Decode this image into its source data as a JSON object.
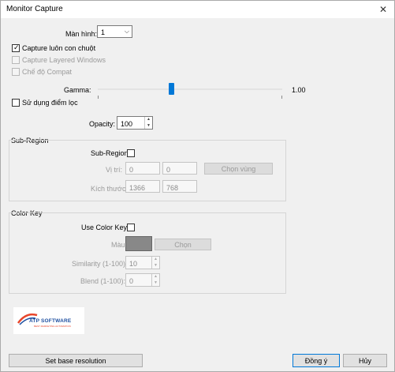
{
  "window": {
    "title": "Monitor Capture",
    "close_glyph": "✕"
  },
  "monitor": {
    "label": "Màn hình:",
    "value": "1",
    "arrow_glyph": "⌵"
  },
  "options": {
    "capture_cursor": {
      "label": "Capture luôn con chuột",
      "checked": true
    },
    "capture_layered": {
      "label": "Capture Layered Windows",
      "checked": false,
      "enabled": false
    },
    "compat_mode": {
      "label": "Chế độ Compat",
      "checked": false,
      "enabled": false
    }
  },
  "gamma": {
    "label": "Gamma:",
    "value_text": "1.00",
    "level": 0.4
  },
  "filter_point": {
    "label": "Sử dụng điểm lọc",
    "checked": false
  },
  "opacity": {
    "label": "Opacity:",
    "value": "100",
    "up_glyph": "▲",
    "down_glyph": "▼"
  },
  "sub_region": {
    "group_label": "Sub-Region",
    "enable_label": "Sub-Region",
    "position_label": "Vị trí:",
    "x": "0",
    "y": "0",
    "choose_button": "Chọn vùng",
    "size_label": "Kích thước:",
    "width": "1366",
    "height": "768"
  },
  "color_key": {
    "group_label": "Color Key",
    "use_label": "Use Color Key:",
    "color_label": "Màu",
    "color_value": "#888888",
    "choose_button": "Chọn",
    "similarity_label": "Similarity (1-100):",
    "similarity_value": "10",
    "blend_label": "Blend (1-100):",
    "blend_value": "0"
  },
  "logo": {
    "text": "ATP SOFTWARE",
    "tagline": "BEST MARKETING AUTOMATION",
    "accent": "#e8462b",
    "brand": "#1e4fa0"
  },
  "footer": {
    "base_resolution_button": "Set base resolution",
    "ok_button": "Đồng ý",
    "cancel_button": "Hủy"
  },
  "colors": {
    "accent": "#0078d7"
  }
}
